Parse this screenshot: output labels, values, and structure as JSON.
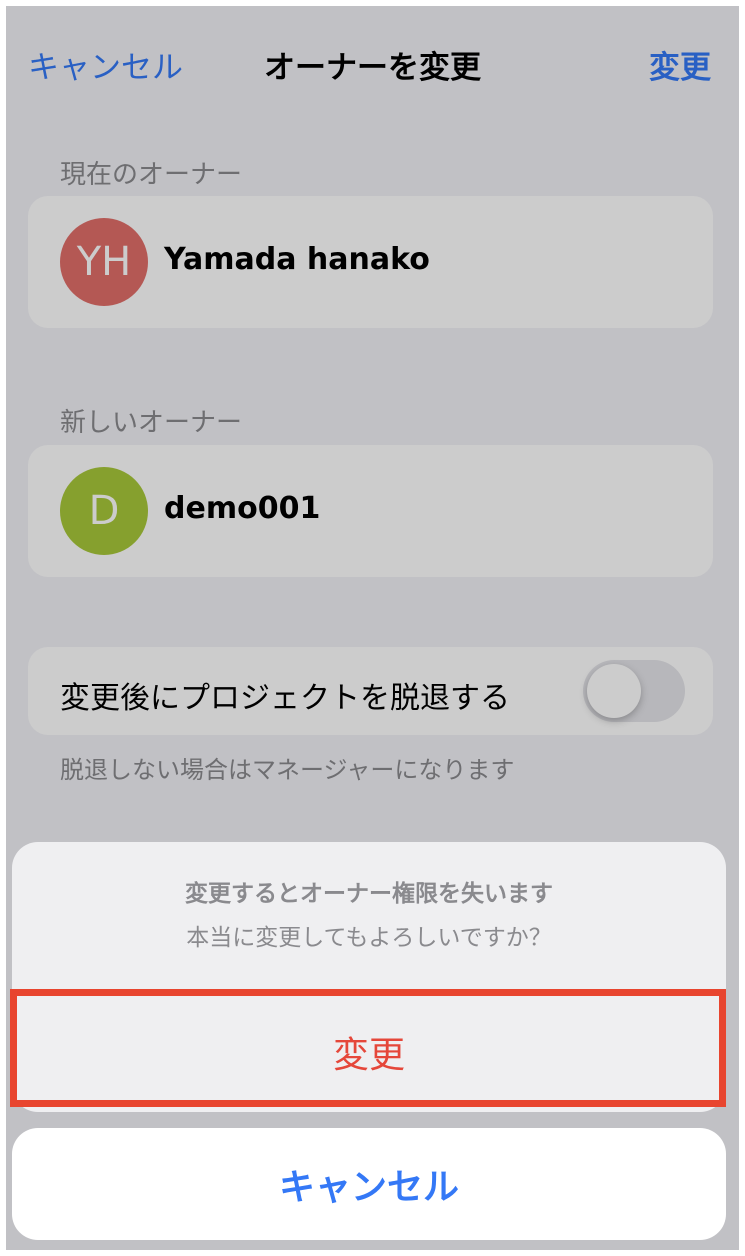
{
  "nav": {
    "cancel_label": "キャンセル",
    "title": "オーナーを変更",
    "change_label": "変更"
  },
  "current_owner": {
    "section_label": "現在のオーナー",
    "initials": "YH",
    "name": "Yamada hanako",
    "avatar_color": "#e26f6a"
  },
  "new_owner": {
    "section_label": "新しいオーナー",
    "initials": "D",
    "name": "demo001",
    "avatar_color": "#a8c83a"
  },
  "leave_option": {
    "label": "変更後にプロジェクトを脱退する",
    "enabled": false,
    "footnote": "脱退しない場合はマネージャーになります"
  },
  "action_sheet": {
    "title": "変更するとオーナー権限を失います",
    "message": "本当に変更してもよろしいですか？",
    "confirm_label": "変更",
    "cancel_label": "キャンセル"
  },
  "colors": {
    "accent": "#3478f6",
    "destructive": "#e5473a",
    "highlight": "#e8452f"
  }
}
